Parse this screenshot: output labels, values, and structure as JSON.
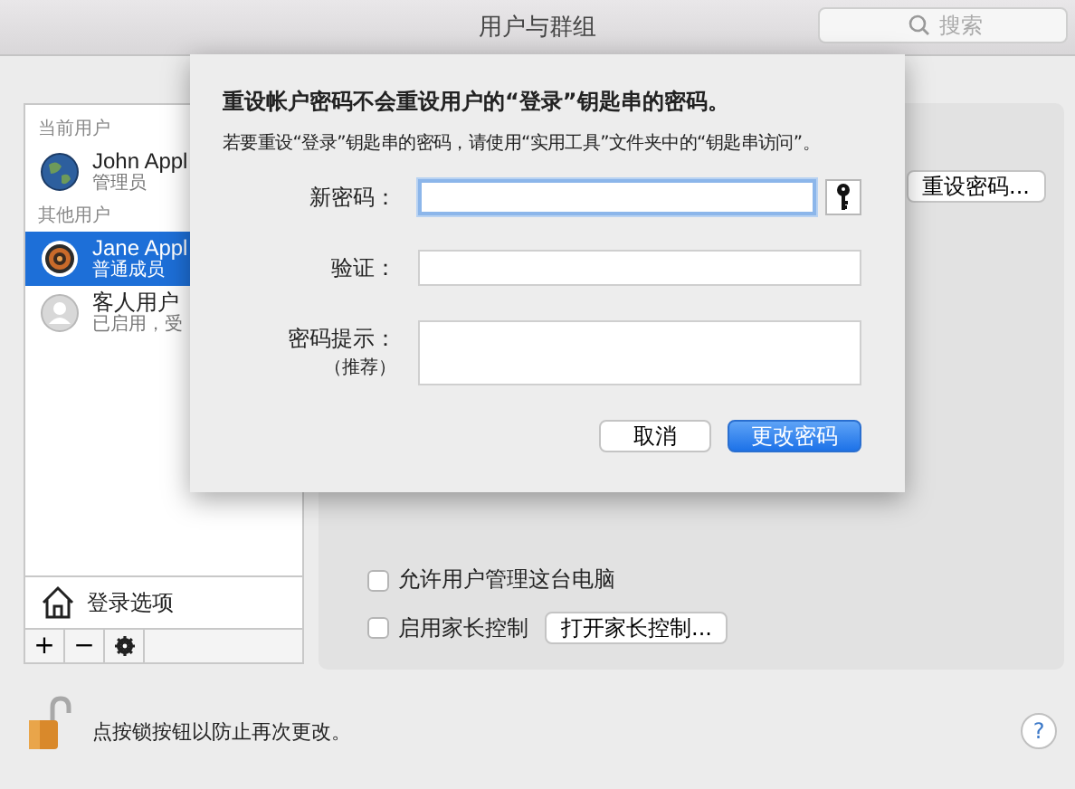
{
  "window": {
    "title": "用户与群组"
  },
  "search": {
    "placeholder": "搜索"
  },
  "sidebar": {
    "groups": [
      {
        "header": "当前用户",
        "users": [
          {
            "name": "John Appl",
            "role": "管理员",
            "kind": "globe",
            "selected": false
          }
        ]
      },
      {
        "header": "其他用户",
        "users": [
          {
            "name": "Jane Appl",
            "role": "普通成员",
            "kind": "target",
            "selected": true
          },
          {
            "name": "客人用户",
            "role": "已启用，受",
            "kind": "guest",
            "selected": false
          }
        ]
      }
    ],
    "login_options": "登录选项",
    "toolbar": [
      "+",
      "−"
    ]
  },
  "panel": {
    "reset_button": "重设密码...",
    "checkboxes": [
      {
        "label": "允许用户管理这台电脑",
        "checked": false
      },
      {
        "label": "启用家长控制",
        "checked": false
      }
    ],
    "parental_button": "打开家长控制..."
  },
  "footer": {
    "lock_text": "点按锁按钮以防止再次更改。",
    "help": "?"
  },
  "sheet": {
    "title": "重设帐户密码不会重设用户的“登录”钥匙串的密码。",
    "message": "若要重设“登录”钥匙串的密码，请使用“实用工具”文件夹中的“钥匙串访问”。",
    "fields": [
      {
        "label": "新密码：",
        "kind": "password",
        "focused": true
      },
      {
        "label": "验证：",
        "kind": "password",
        "focused": false
      },
      {
        "label": "密码提示：",
        "sublabel": "（推荐）",
        "kind": "textarea",
        "focused": false
      }
    ],
    "buttons": [
      {
        "label": "取消",
        "default": false
      },
      {
        "label": "更改密码",
        "default": true
      }
    ]
  }
}
